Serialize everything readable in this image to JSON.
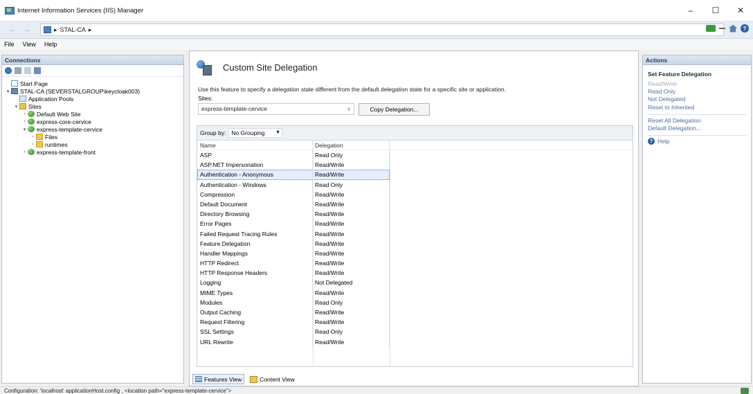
{
  "window": {
    "title": "Internet Information Services (IIS) Manager",
    "controls": {
      "minimize": "–",
      "maximize": "☐",
      "close": "✕"
    }
  },
  "address": {
    "crumbs": [
      "▸",
      "STAL-CA",
      "▸"
    ]
  },
  "menu": {
    "items": [
      "File",
      "View",
      "Help"
    ]
  },
  "connections": {
    "header": "Connections",
    "tree": [
      {
        "label": "Start Page",
        "icon": "page",
        "level": 0,
        "twisty": ""
      },
      {
        "label": "STAL-CA (SEVERSTALGROUP\\keycloak003)",
        "icon": "server",
        "level": 0,
        "twisty": "▾"
      },
      {
        "label": "Application Pools",
        "icon": "pool",
        "level": 1,
        "twisty": ""
      },
      {
        "label": "Sites",
        "icon": "sites",
        "level": 1,
        "twisty": "▾"
      },
      {
        "label": "Default Web Site",
        "icon": "globe",
        "level": 2,
        "twisty": "›"
      },
      {
        "label": "express-core-cervice",
        "icon": "globe",
        "level": 2,
        "twisty": "›"
      },
      {
        "label": "express-template-cervice",
        "icon": "globe",
        "level": 2,
        "twisty": "▾"
      },
      {
        "label": "Files",
        "icon": "folder",
        "level": 3,
        "twisty": "›"
      },
      {
        "label": "runtimes",
        "icon": "folder",
        "level": 3,
        "twisty": "›"
      },
      {
        "label": "express-template-front",
        "icon": "globe",
        "level": 2,
        "twisty": "›"
      }
    ]
  },
  "main": {
    "title": "Custom Site Delegation",
    "description": "Use this feature to specify a delegation state different from the default delegation state for a specific site or application.",
    "sites_label": "Sites:",
    "sites_value": "express-template-cervice",
    "copy_button": "Copy Delegation...",
    "group_by_label": "Group by:",
    "group_by_value": "No Grouping",
    "columns": {
      "name": "Name",
      "delegation": "Delegation"
    },
    "selected_row": 2,
    "rows": [
      {
        "name": "ASP",
        "delegation": "Read Only"
      },
      {
        "name": "ASP.NET Impersonation",
        "delegation": "Read/Write"
      },
      {
        "name": "Authentication - Anonymous",
        "delegation": "Read/Write"
      },
      {
        "name": "Authentication - Windows",
        "delegation": "Read Only"
      },
      {
        "name": "Compression",
        "delegation": "Read/Write"
      },
      {
        "name": "Default Document",
        "delegation": "Read/Write"
      },
      {
        "name": "Directory Browsing",
        "delegation": "Read/Write"
      },
      {
        "name": "Error Pages",
        "delegation": "Read/Write"
      },
      {
        "name": "Failed Request Tracing Rules",
        "delegation": "Read/Write"
      },
      {
        "name": "Feature Delegation",
        "delegation": "Read/Write"
      },
      {
        "name": "Handler Mappings",
        "delegation": "Read/Write"
      },
      {
        "name": "HTTP Redirect",
        "delegation": "Read/Write"
      },
      {
        "name": "HTTP Response Headers",
        "delegation": "Read/Write"
      },
      {
        "name": "Logging",
        "delegation": "Not Delegated"
      },
      {
        "name": "MIME Types",
        "delegation": "Read/Write"
      },
      {
        "name": "Modules",
        "delegation": "Read Only"
      },
      {
        "name": "Output Caching",
        "delegation": "Read/Write"
      },
      {
        "name": "Request Filtering",
        "delegation": "Read/Write"
      },
      {
        "name": "SSL Settings",
        "delegation": "Read Only"
      },
      {
        "name": "URL Rewrite",
        "delegation": "Read/Write"
      }
    ],
    "view_tabs": {
      "features": "Features View",
      "content": "Content View"
    }
  },
  "actions": {
    "header": "Actions",
    "title": "Set Feature Delegation",
    "items": [
      {
        "label": "Read/Write",
        "state": "disabled"
      },
      {
        "label": "Read Only",
        "state": "link"
      },
      {
        "label": "Not Delegated",
        "state": "link"
      },
      {
        "label": "Reset to Inherited",
        "state": "link"
      }
    ],
    "items2": [
      {
        "label": "Reset All Delegation",
        "state": "link"
      },
      {
        "label": "Default Delegation...",
        "state": "link"
      }
    ],
    "help": "Help"
  },
  "status": {
    "text": "Configuration: 'localhost' applicationHost.config , <location path=\"express-template-cervice\">"
  },
  "colors": {
    "panel_header": "#c9d5e6",
    "link": "#4a6fa5",
    "disabled": "#a7b2c1",
    "selection": "#e5eefb"
  }
}
